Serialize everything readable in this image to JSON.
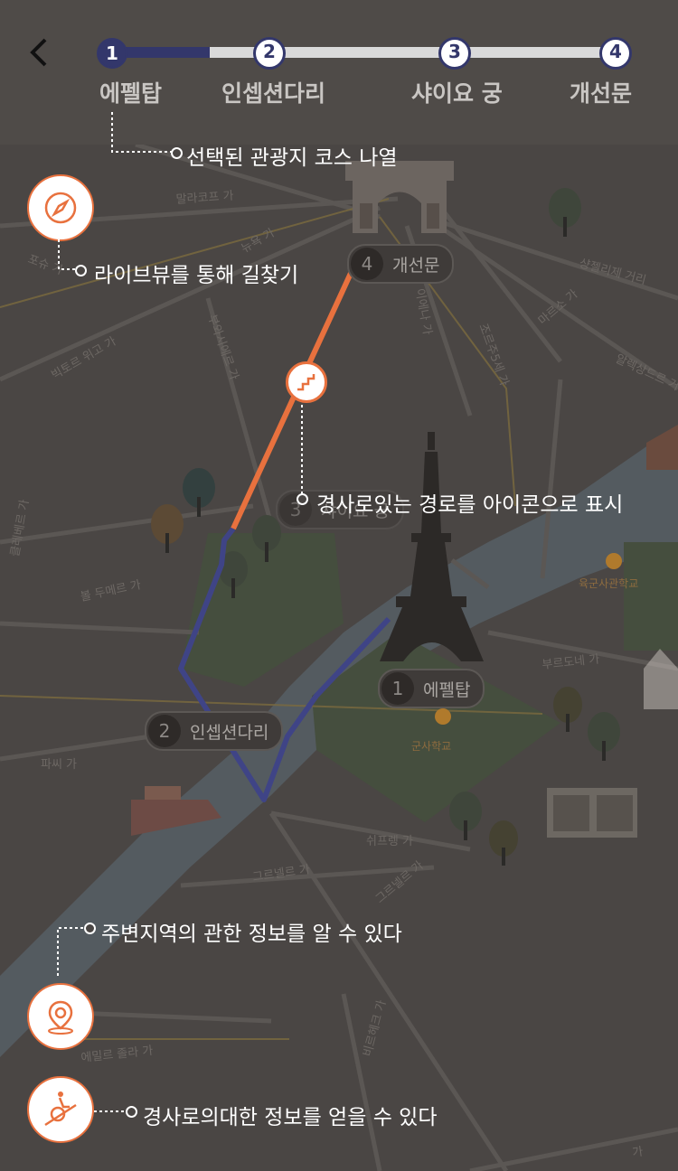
{
  "header": {
    "steps": [
      {
        "number": "1",
        "label": "에펠탑"
      },
      {
        "number": "2",
        "label": "인셉션다리"
      },
      {
        "number": "3",
        "label": "샤이요 궁"
      },
      {
        "number": "4",
        "label": "개선문"
      }
    ],
    "progress_fill": 0.2
  },
  "annotations": {
    "course_list": "선택된 관광지 코스 나열",
    "liveview": "라이브뷰를 통해 길찾기",
    "slope_route": "경사로있는 경로를 아이콘으로 표시",
    "nearby_info": "주변지역의 관한 정보를 알 수 있다",
    "slope_info": "경사로의대한 정보를 얻을 수 있다"
  },
  "map": {
    "markers": [
      {
        "number": "4",
        "label": "개선문"
      },
      {
        "number": "3",
        "label": "샤이요 궁"
      },
      {
        "number": "2",
        "label": "인셉션다리"
      },
      {
        "number": "1",
        "label": "에펠탑"
      }
    ],
    "streets": [
      "말라코프 가",
      "포슈 가",
      "빅토르 위고 가",
      "부와시에르 가",
      "이에나 가",
      "조르주 5세 가",
      "마르소 가",
      "샹젤리제 거리",
      "알렉상드르 거리",
      "뉴욕 가",
      "브랑리 가",
      "부르도네 가",
      "쉬프랑 가",
      "그르넬르 가",
      "파씨 가",
      "에밀르 졸라 가",
      "클레베르 가"
    ],
    "poi": [
      "군사학교"
    ]
  },
  "colors": {
    "accent": "#e8713e",
    "route_done": "#3f4486",
    "nav": "#33376b"
  }
}
